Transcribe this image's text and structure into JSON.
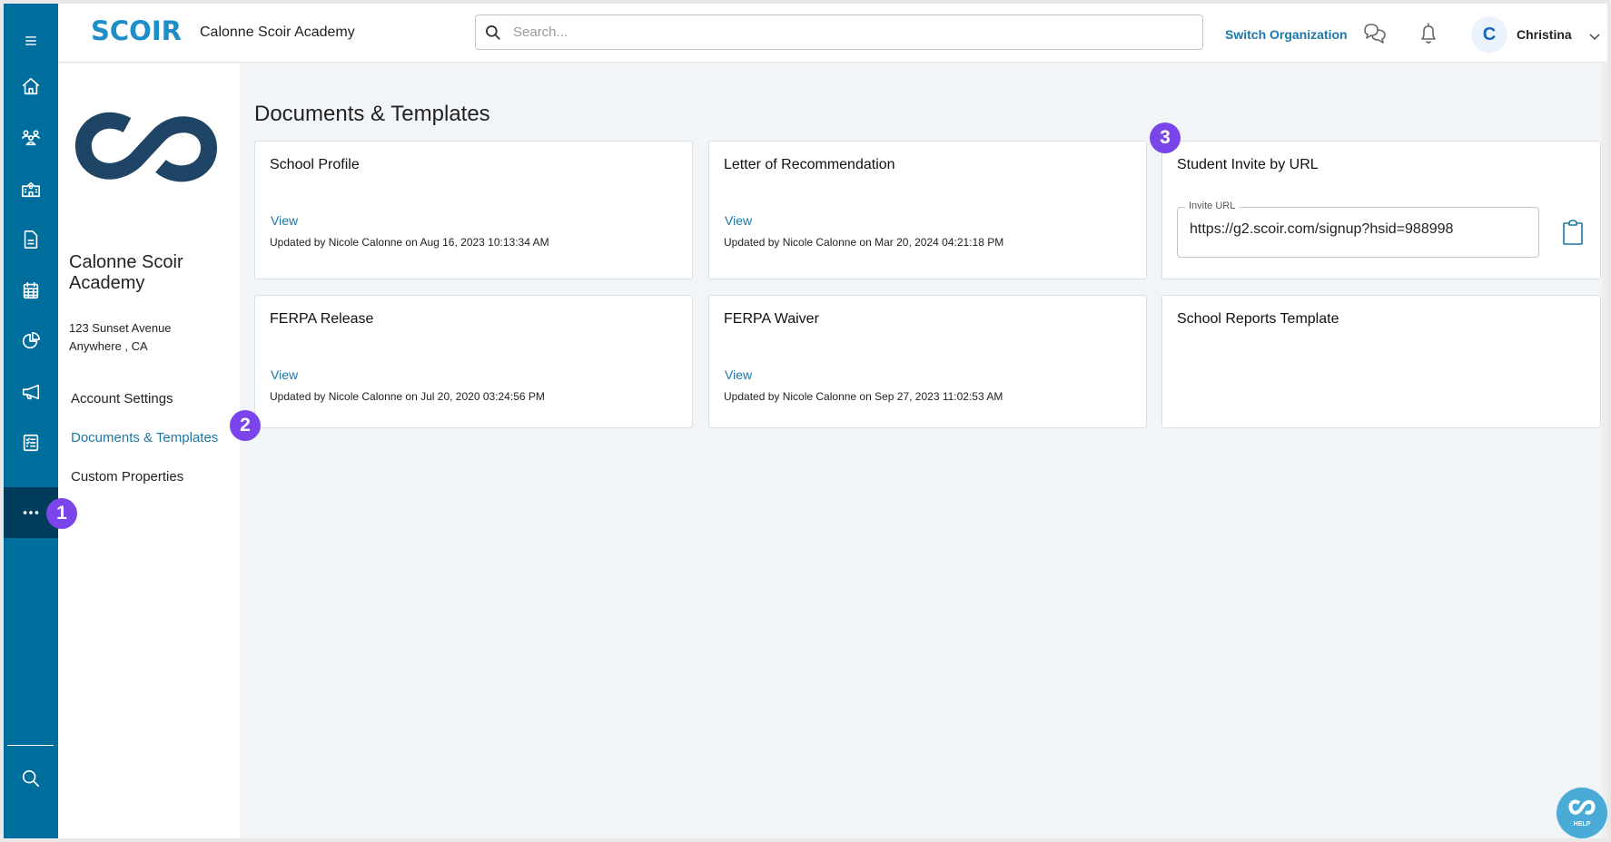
{
  "header": {
    "brand": "SCOIR",
    "org_name": "Calonne Scoir Academy",
    "search_placeholder": "Search...",
    "switch_org_label": "Switch Organization",
    "user_initial": "C",
    "user_name": "Christina"
  },
  "rail": {
    "items": [
      {
        "icon": "menu-icon"
      },
      {
        "icon": "home-icon"
      },
      {
        "icon": "students-icon"
      },
      {
        "icon": "school-icon"
      },
      {
        "icon": "document-icon"
      },
      {
        "icon": "calendar-icon"
      },
      {
        "icon": "pie-chart-icon"
      },
      {
        "icon": "megaphone-icon"
      },
      {
        "icon": "checklist-icon"
      },
      {
        "icon": "more-icon",
        "active": true
      },
      {
        "icon": "search-icon"
      }
    ]
  },
  "side_panel": {
    "school_name": "Calonne Scoir Academy",
    "address_line1": "123 Sunset Avenue",
    "address_line2": "Anywhere , CA",
    "links": [
      {
        "label": "Account Settings",
        "active": false
      },
      {
        "label": "Documents & Templates",
        "active": true
      },
      {
        "label": "Custom Properties",
        "active": false
      }
    ]
  },
  "main": {
    "title": "Documents & Templates",
    "cards": [
      {
        "title": "School Profile",
        "view_label": "View",
        "updated": "Updated by Nicole Calonne on Aug 16, 2023 10:13:34 AM"
      },
      {
        "title": "Letter of Recommendation",
        "view_label": "View",
        "updated": "Updated by Nicole Calonne on Mar 20, 2024 04:21:18 PM"
      },
      {
        "title": "Student Invite by URL",
        "field_label": "Invite URL",
        "field_value": "https://g2.scoir.com/signup?hsid=988998"
      },
      {
        "title": "FERPA Release",
        "view_label": "View",
        "updated": "Updated by Nicole Calonne on Jul 20, 2020 03:24:56 PM"
      },
      {
        "title": "FERPA Waiver",
        "view_label": "View",
        "updated": "Updated by Nicole Calonne on Sep 27, 2023 11:02:53 AM"
      },
      {
        "title": "School Reports Template"
      }
    ]
  },
  "annotations": [
    "1",
    "2",
    "3"
  ],
  "help": {
    "label": "HELP"
  },
  "colors": {
    "rail": "#006e9c",
    "rail_active": "#003d5c",
    "accent": "#1c77a8",
    "badge": "#7b45ec",
    "help": "#4aabd6"
  }
}
